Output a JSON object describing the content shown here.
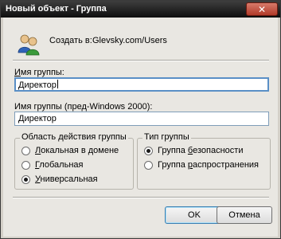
{
  "window": {
    "title": "Новый объект - Группа",
    "close_glyph": "✕"
  },
  "created_in": {
    "label": "Создать в:",
    "value": "Glevsky.com/Users"
  },
  "group_name": {
    "label_underlined": "И",
    "label_rest": "мя группы:",
    "value": "Директор"
  },
  "group_name_pre2000": {
    "label": "Имя группы (пред-Windows 2000):",
    "value": "Директор"
  },
  "scope": {
    "title": "Область действия группы",
    "options": [
      {
        "underlined": "Л",
        "rest": "окальная в домене",
        "checked": false
      },
      {
        "underlined": "Г",
        "rest": "лобальная",
        "checked": false
      },
      {
        "underlined": "У",
        "rest": "ниверсальная",
        "checked": true
      }
    ]
  },
  "type": {
    "title": "Тип группы",
    "options": [
      {
        "prefix": "Группа ",
        "underlined": "б",
        "rest": "езопасности",
        "checked": true
      },
      {
        "prefix": "Группа ",
        "underlined": "р",
        "rest": "аспространения",
        "checked": false
      }
    ]
  },
  "buttons": {
    "ok": "OK",
    "cancel": "Отмена"
  },
  "icons": {
    "header": "users-group-icon"
  }
}
